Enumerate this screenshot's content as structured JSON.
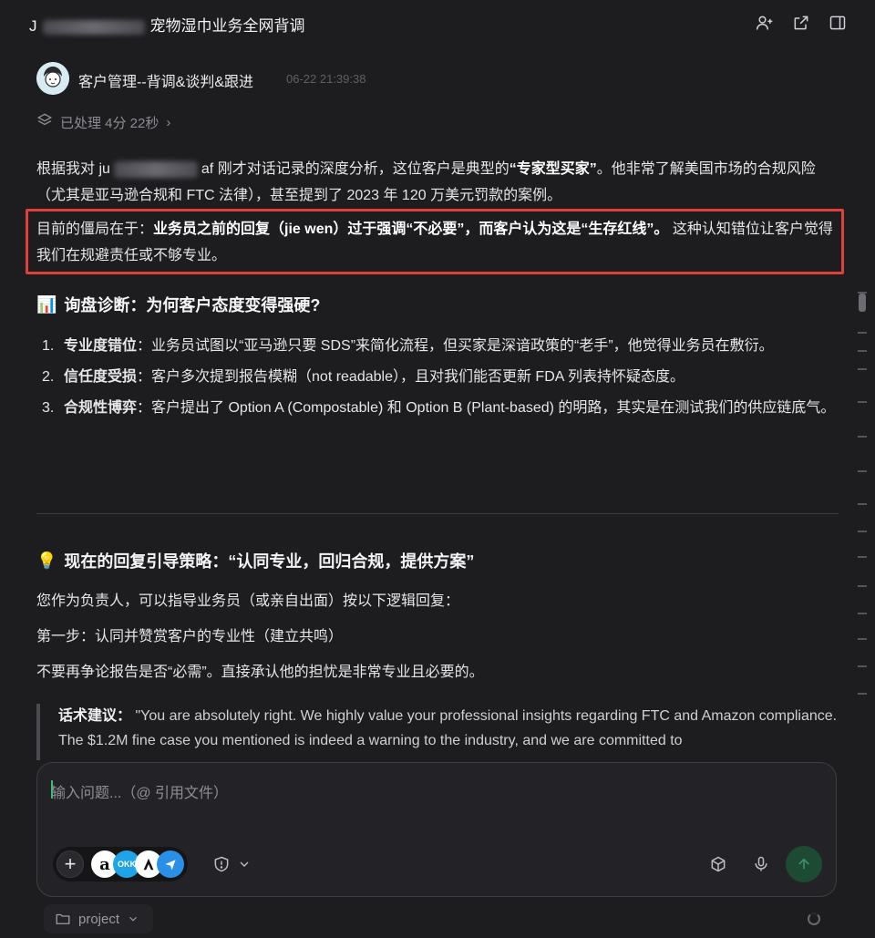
{
  "header": {
    "title_prefix": "J",
    "title": "宠物湿巾业务全网背调"
  },
  "message": {
    "agent_name": "客户管理--背调&谈判&跟进",
    "timestamp": "06-22 21:39:38",
    "processed": "已处理 4分 22秒"
  },
  "intro": {
    "p1_a": "根据我对 ju",
    "p1_b": "af 刚才对话记录的深度分析，这位客户是典型的",
    "p1_bold": "“专家型买家”",
    "p1_c": "。他非常了解美国市场的合规风险（尤其是亚马逊合规和 FTC 法律），甚至提到了 2023 年 120 万美元罚款的案例。",
    "p2_a": "目前的僵局在于：",
    "p2_bold": "业务员之前的回复（jie wen）过于强调“不必要”，而客户认为这是“生存红线”。",
    "p2_c": " 这种认知错位让客户觉得我们在规避责任或不够专业。"
  },
  "section1": {
    "icon": "📊",
    "title": "询盘诊断：为何客户态度变得强硬?",
    "items": [
      {
        "num": "1.",
        "bold": "专业度错位",
        "text": "：业务员试图以“亚马逊只要 SDS”来简化流程，但买家是深谙政策的“老手”，他觉得业务员在敷衍。"
      },
      {
        "num": "2.",
        "bold": "信任度受损",
        "text": "：客户多次提到报告模糊（not readable），且对我们能否更新 FDA 列表持怀疑态度。"
      },
      {
        "num": "3.",
        "bold": "合规性博弈",
        "text": "：客户提出了 Option A (Compostable) 和 Option B (Plant-based) 的明路，其实是在测试我们的供应链底气。"
      }
    ]
  },
  "section2": {
    "icon": "💡",
    "title": "现在的回复引导策略：“认同专业，回归合规，提供方案”",
    "line1": "您作为负责人，可以指导业务员（或亲自出面）按以下逻辑回复：",
    "line2": "第一步：认同并赞赏客户的专业性（建立共鸣）",
    "line3": "不要再争论报告是否“必需”。直接承认他的担忧是非常专业且必要的。",
    "quote_label": "话术建议：",
    "quote_text": " \"You are absolutely right. We highly value your professional insights regarding FTC and Amazon compliance. The $1.2M fine case you mentioned is indeed a warning to the industry, and we are committed to"
  },
  "composer": {
    "placeholder": "输入问题...（@ 引用文件）"
  },
  "footer": {
    "project_label": "project"
  },
  "colors": {
    "background": "#1d1d20",
    "highlight_border": "#e0403c",
    "send_button": "#1c4a33"
  }
}
